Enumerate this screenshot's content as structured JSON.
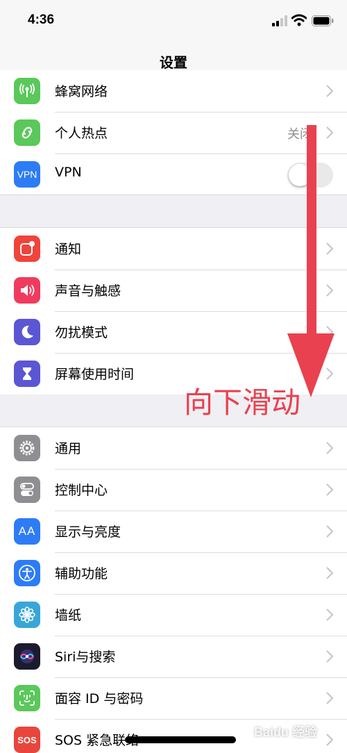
{
  "status_bar": {
    "time": "4:36"
  },
  "nav": {
    "title": "设置"
  },
  "sections": [
    [
      {
        "label": "蜂窝网络",
        "icon": "antenna-icon",
        "color": "#5ac85a"
      },
      {
        "label": "个人热点",
        "icon": "hotspot-icon",
        "color": "#5ac85a",
        "value": "关闭"
      },
      {
        "label": "VPN",
        "icon": "vpn-icon",
        "color": "#2d7cf6",
        "toggle_on": false
      }
    ],
    [
      {
        "label": "通知",
        "icon": "notification-icon",
        "color": "#f0443b"
      },
      {
        "label": "声音与触感",
        "icon": "speaker-icon",
        "color": "#f03b5e"
      },
      {
        "label": "勿扰模式",
        "icon": "moon-icon",
        "color": "#5b56d3"
      },
      {
        "label": "屏幕使用时间",
        "icon": "hourglass-icon",
        "color": "#5b56d3"
      }
    ],
    [
      {
        "label": "通用",
        "icon": "gear-icon",
        "color": "#8e8e93"
      },
      {
        "label": "控制中心",
        "icon": "switches-icon",
        "color": "#8e8e93"
      },
      {
        "label": "显示与亮度",
        "icon": "text-size-icon",
        "color": "#2d7cf6",
        "icon_text": "AA"
      },
      {
        "label": "辅助功能",
        "icon": "accessibility-icon",
        "color": "#2d7cf6"
      },
      {
        "label": "墙纸",
        "icon": "flower-icon",
        "color": "#39a6d8"
      },
      {
        "label": "Siri与搜索",
        "icon": "siri-icon",
        "color": "#1b1b2e"
      },
      {
        "label": "面容 ID 与密码",
        "icon": "face-id-icon",
        "color": "#5ac85a"
      },
      {
        "label": "SOS 紧急联络",
        "icon": "sos-icon",
        "color": "#e8463c",
        "icon_text": "SOS"
      }
    ]
  ],
  "annotation": {
    "text": "向下滑动",
    "color": "#e9414f"
  },
  "watermark": {
    "text": "Baidu 经验"
  }
}
